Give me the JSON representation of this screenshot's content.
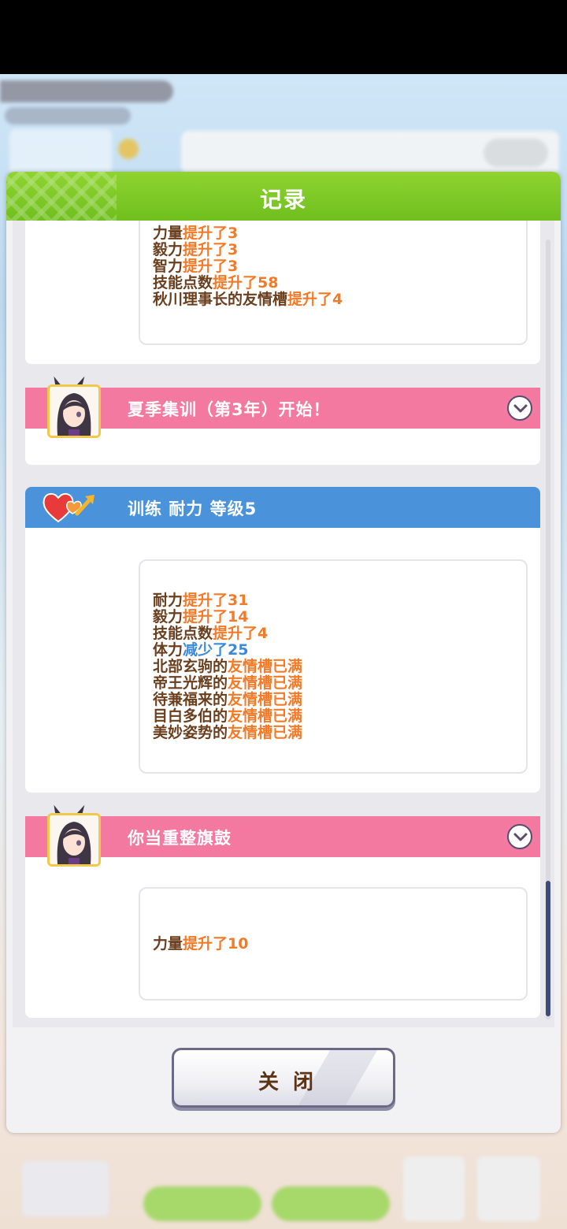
{
  "dialog": {
    "title": "记录"
  },
  "entries": [
    {
      "lines": [
        {
          "label": "力量",
          "effect": "提升了3",
          "kind": "up"
        },
        {
          "label": "毅力",
          "effect": "提升了3",
          "kind": "up"
        },
        {
          "label": "智力",
          "effect": "提升了3",
          "kind": "up"
        },
        {
          "label": "技能点数",
          "effect": "提升了58",
          "kind": "up"
        },
        {
          "label": "秋川理事长的友情槽",
          "effect": "提升了4",
          "kind": "up"
        }
      ]
    },
    {
      "title": "夏季集训（第3年）开始！",
      "color": "#f479a1"
    },
    {
      "title": "训练 耐力 等级5",
      "color": "#4a93da",
      "lines": [
        {
          "label": "耐力",
          "effect": "提升了31",
          "kind": "up"
        },
        {
          "label": "毅力",
          "effect": "提升了14",
          "kind": "up"
        },
        {
          "label": "技能点数",
          "effect": "提升了4",
          "kind": "up"
        },
        {
          "label": "体力",
          "effect": "减少了25",
          "kind": "down"
        },
        {
          "label": "北部玄驹的",
          "effect": "友情槽已满",
          "kind": "up"
        },
        {
          "label": "帝王光辉的",
          "effect": "友情槽已满",
          "kind": "up"
        },
        {
          "label": "待兼福来的",
          "effect": "友情槽已满",
          "kind": "up"
        },
        {
          "label": "目白多伯的",
          "effect": "友情槽已满",
          "kind": "up"
        },
        {
          "label": "美妙姿势的",
          "effect": "友情槽已满",
          "kind": "up"
        }
      ]
    },
    {
      "title": "你当重整旗鼓",
      "color": "#f479a1",
      "lines": [
        {
          "label": "力量",
          "effect": "提升了10",
          "kind": "up"
        }
      ]
    }
  ],
  "close_button": {
    "label": "关闭"
  }
}
